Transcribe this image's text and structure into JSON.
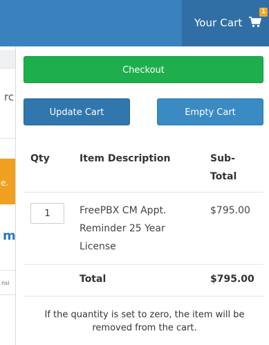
{
  "header": {
    "cart_label": "Your Cart",
    "cart_count": "1",
    "cart_icon": "cart-icon",
    "bar_color": "#3a82bd",
    "tab_color": "#2f6fa6",
    "badge_color": "#f5a623"
  },
  "background_page": {
    "text_fragment_1": "rc",
    "orange_fragment": "e.",
    "blue_fragment": "m",
    "small_fragment": "nsi"
  },
  "cart": {
    "checkout_label": "Checkout",
    "update_label": "Update Cart",
    "empty_label": "Empty Cart",
    "columns": {
      "qty": "Qty",
      "description": "Item Description",
      "subtotal": "Sub-Total"
    },
    "items": [
      {
        "qty": "1",
        "description": "FreePBX CM Appt. Reminder 25 Year License",
        "price": "$795.00"
      }
    ],
    "total_label": "Total",
    "total_value": "$795.00",
    "note": "If the quantity is set to zero, the item will be removed from the cart.",
    "colors": {
      "checkout": "#1fae4d",
      "update": "#3176ad",
      "empty": "#3a8ac4"
    }
  }
}
